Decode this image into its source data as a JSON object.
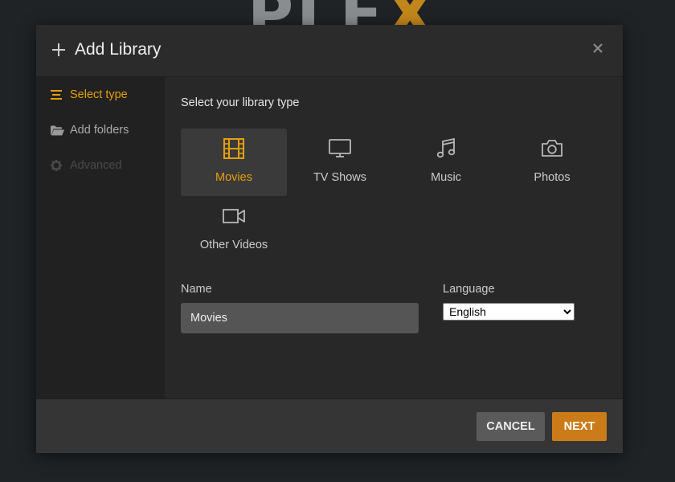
{
  "background": {
    "logo_text_main": "PLE",
    "logo_text_accent": "X"
  },
  "modal": {
    "title": "Add Library",
    "header_icon": "plus-icon",
    "close_icon": "close-icon"
  },
  "sidebar": {
    "items": [
      {
        "label": "Select type",
        "icon": "list-icon",
        "state": "active"
      },
      {
        "label": "Add folders",
        "icon": "folder-open-icon",
        "state": "normal"
      },
      {
        "label": "Advanced",
        "icon": "gear-icon",
        "state": "disabled"
      }
    ]
  },
  "content": {
    "section_title": "Select your library type",
    "library_types": [
      {
        "label": "Movies",
        "icon": "film-icon",
        "selected": true
      },
      {
        "label": "TV Shows",
        "icon": "tv-icon",
        "selected": false
      },
      {
        "label": "Music",
        "icon": "music-note-icon",
        "selected": false
      },
      {
        "label": "Photos",
        "icon": "camera-icon",
        "selected": false
      },
      {
        "label": "Other Videos",
        "icon": "video-camera-icon",
        "selected": false
      }
    ],
    "name_label": "Name",
    "name_value": "Movies",
    "language_label": "Language",
    "language_selected": "English"
  },
  "footer": {
    "cancel_label": "CANCEL",
    "next_label": "NEXT"
  },
  "colors": {
    "accent": "#e5a00d",
    "next_button": "#cc7b19",
    "cancel_button": "#5a5a5a",
    "modal_bg": "#282828",
    "sidebar_bg": "#212121",
    "footer_bg": "#353535",
    "page_bg": "#1f2326"
  }
}
